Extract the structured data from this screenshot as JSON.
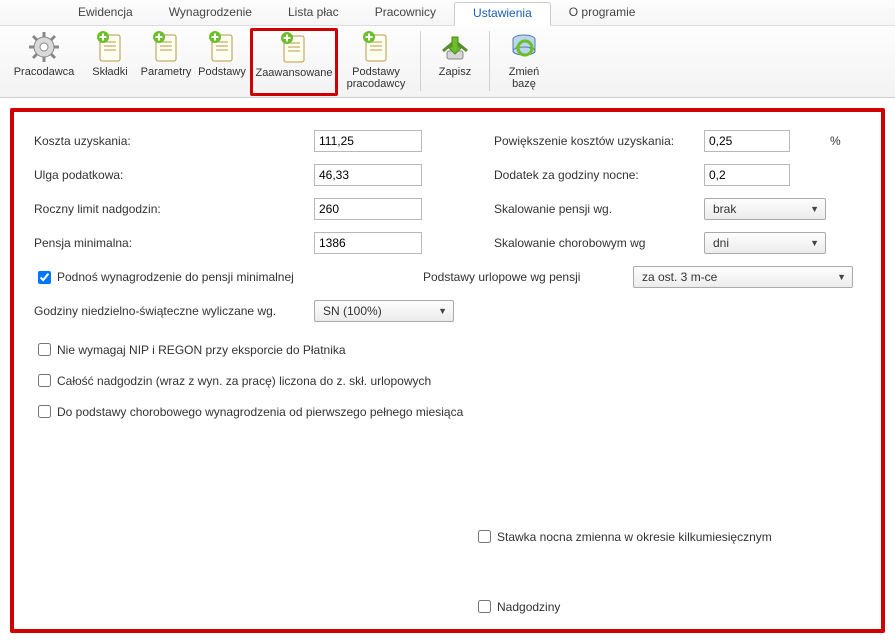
{
  "menu": {
    "items": [
      "Ewidencja",
      "Wynagrodzenie",
      "Lista płac",
      "Pracownicy",
      "Ustawienia",
      "O programie"
    ],
    "active_index": 4
  },
  "toolbar": {
    "items": [
      {
        "label": "Pracodawca",
        "icon": "gear"
      },
      {
        "label": "Składki",
        "icon": "doc-plus"
      },
      {
        "label": "Parametry",
        "icon": "doc-plus"
      },
      {
        "label": "Podstawy",
        "icon": "doc-plus"
      },
      {
        "label": "Zaawansowane",
        "icon": "doc-plus",
        "highlight": true
      },
      {
        "label": "Podstawy pracodawcy",
        "icon": "doc-plus"
      },
      {
        "label": "Zapisz",
        "icon": "save"
      },
      {
        "label": "Zmień bazę",
        "icon": "db-refresh"
      }
    ]
  },
  "form": {
    "koszta_uzyskania_label": "Koszta uzyskania:",
    "koszta_uzyskania_value": "111,25",
    "powiekszenie_label": "Powiększenie kosztów uzyskania:",
    "powiekszenie_value": "0,25",
    "pct_sign": "%",
    "ulga_label": "Ulga podatkowa:",
    "ulga_value": "46,33",
    "dodatek_label": "Dodatek za godziny nocne:",
    "dodatek_value": "0,2",
    "roczny_limit_label": "Roczny limit nadgodzin:",
    "roczny_limit_value": "260",
    "skalowanie_pensji_label": "Skalowanie pensji wg.",
    "skalowanie_pensji_value": "brak",
    "pensja_min_label": "Pensja minimalna:",
    "pensja_min_value": "1386",
    "skalowanie_chor_label": "Skalowanie chorobowym wg",
    "skalowanie_chor_value": "dni",
    "podnos_label": "Podnoś wynagrodzenie do pensji minimalnej",
    "podnos_checked": true,
    "podstawy_url_label": "Podstawy urlopowe wg pensji",
    "podstawy_url_value": "za ost. 3 m-ce",
    "godziny_sw_label": "Godziny niedzielno-świąteczne wyliczane wg.",
    "godziny_sw_value": "SN (100%)",
    "cb_nip": "Nie wymagaj NIP i REGON przy eksporcie do Płatnika",
    "cb_calosc": "Całość nadgodzin (wraz z wyn. za pracę) liczona do z. skł. urlopowych",
    "cb_podst": "Do podstawy chorobowego wynagrodzenia od pierwszego pełnego miesiąca",
    "cb_stawka": "Stawka nocna zmienna w okresie kilkumiesięcznym",
    "cb_nadgodziny": "Nadgodziny"
  }
}
